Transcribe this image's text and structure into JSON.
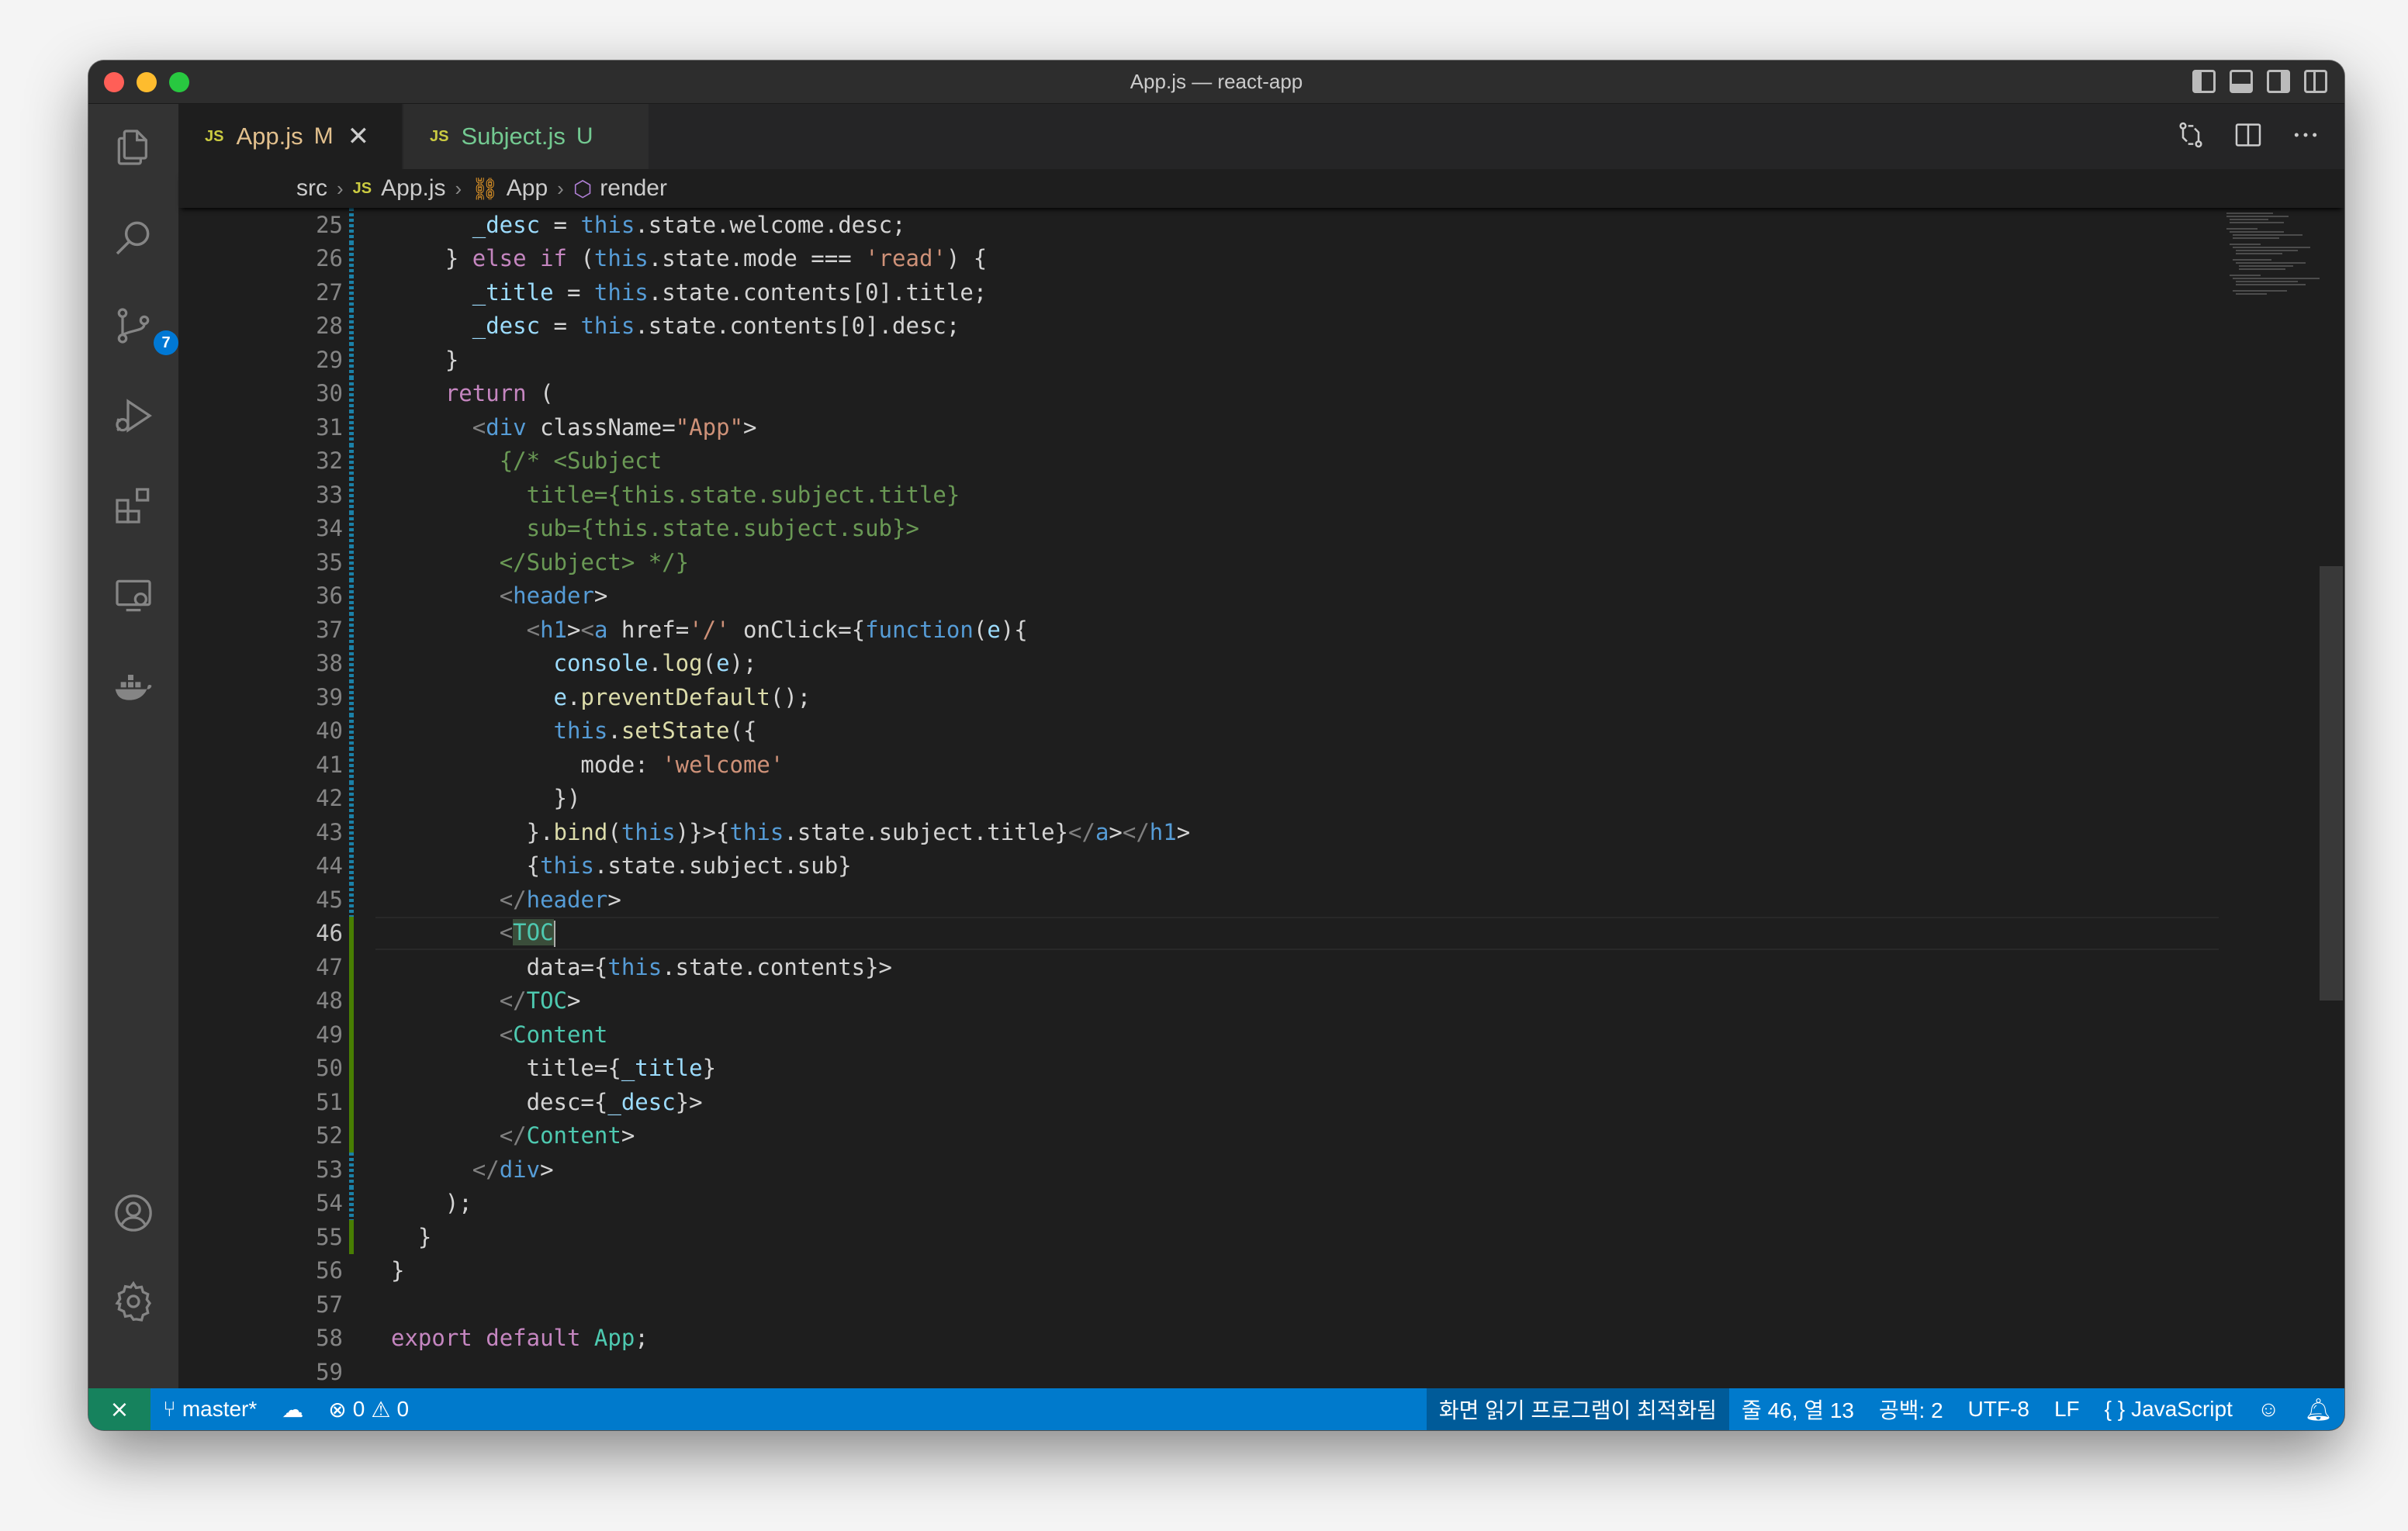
{
  "window": {
    "title": "App.js — react-app"
  },
  "activity_bar": {
    "items": [
      {
        "name": "explorer-icon"
      },
      {
        "name": "search-icon"
      },
      {
        "name": "source-control-icon",
        "badge": "7"
      },
      {
        "name": "run-debug-icon"
      },
      {
        "name": "extensions-icon"
      },
      {
        "name": "remote-explorer-icon"
      },
      {
        "name": "docker-icon"
      }
    ],
    "bottom": [
      {
        "name": "account-icon"
      },
      {
        "name": "settings-gear-icon"
      }
    ]
  },
  "tabs": [
    {
      "badge": "JS",
      "label": "App.js",
      "status": "M",
      "active": true
    },
    {
      "badge": "JS",
      "label": "Subject.js",
      "status": "U",
      "active": false
    }
  ],
  "editor_actions": [
    "open-changes-icon",
    "split-editor-icon",
    "more-actions-icon"
  ],
  "breadcrumbs": {
    "folder": "src",
    "file_badge": "JS",
    "file": "App.js",
    "class": "App",
    "method": "render"
  },
  "editor": {
    "current_line": 46,
    "lines": [
      {
        "n": "25",
        "g": "mod"
      },
      {
        "n": "26",
        "g": "mod"
      },
      {
        "n": "27",
        "g": "mod"
      },
      {
        "n": "28",
        "g": "mod"
      },
      {
        "n": "29",
        "g": "mod"
      },
      {
        "n": "30",
        "g": "mod"
      },
      {
        "n": "31",
        "g": "mod"
      },
      {
        "n": "32",
        "g": "mod"
      },
      {
        "n": "33",
        "g": "mod"
      },
      {
        "n": "34",
        "g": "mod"
      },
      {
        "n": "35",
        "g": "mod"
      },
      {
        "n": "36",
        "g": "mod"
      },
      {
        "n": "37",
        "g": "mod"
      },
      {
        "n": "38",
        "g": "mod"
      },
      {
        "n": "39",
        "g": "mod"
      },
      {
        "n": "40",
        "g": "mod"
      },
      {
        "n": "41",
        "g": "mod"
      },
      {
        "n": "42",
        "g": "mod"
      },
      {
        "n": "43",
        "g": "mod"
      },
      {
        "n": "44",
        "g": "mod"
      },
      {
        "n": "45",
        "g": "mod"
      },
      {
        "n": "46",
        "g": "add"
      },
      {
        "n": "47",
        "g": "add"
      },
      {
        "n": "48",
        "g": "add"
      },
      {
        "n": "49",
        "g": "add"
      },
      {
        "n": "50",
        "g": "add"
      },
      {
        "n": "51",
        "g": "add"
      },
      {
        "n": "52",
        "g": "add"
      },
      {
        "n": "53",
        "g": "mod"
      },
      {
        "n": "54",
        "g": "mod"
      },
      {
        "n": "55",
        "g": "add"
      },
      {
        "n": "56",
        "g": ""
      },
      {
        "n": "57",
        "g": ""
      },
      {
        "n": "58",
        "g": ""
      },
      {
        "n": "59",
        "g": ""
      }
    ],
    "code": [
      "      _desc = this.state.welcome.desc;",
      "    } else if (this.state.mode === 'read') {",
      "      _title = this.state.contents[0].title;",
      "      _desc = this.state.contents[0].desc;",
      "    }",
      "    return (",
      "      <div className=\"App\">",
      "        {/* <Subject",
      "          title={this.state.subject.title}",
      "          sub={this.state.subject.sub}>",
      "        </Subject> */}",
      "        <header>",
      "          <h1><a href='/' onClick={function(e){",
      "            console.log(e);",
      "            e.preventDefault();",
      "            this.setState({",
      "              mode: 'welcome'",
      "            })",
      "          }.bind(this)}>{this.state.subject.title}</a></h1>",
      "          {this.state.subject.sub}",
      "        </header>",
      "        <TOC",
      "          data={this.state.contents}>",
      "        </TOC>",
      "        <Content",
      "          title={_title}",
      "          desc={_desc}>",
      "        </Content>",
      "      </div>",
      "    );",
      "  }",
      "}",
      "",
      "export default App;",
      ""
    ]
  },
  "status_bar": {
    "remote_icon": "remote-icon",
    "branch": "master*",
    "sync_icon": "cloud-sync-icon",
    "errors": "0",
    "warnings": "0",
    "screen_reader": "화면 읽기 프로그램이 최적화됨",
    "position": "줄 46, 열 13",
    "indent": "공백: 2",
    "encoding": "UTF-8",
    "eol": "LF",
    "language": "JavaScript",
    "language_icon": "{ }"
  }
}
